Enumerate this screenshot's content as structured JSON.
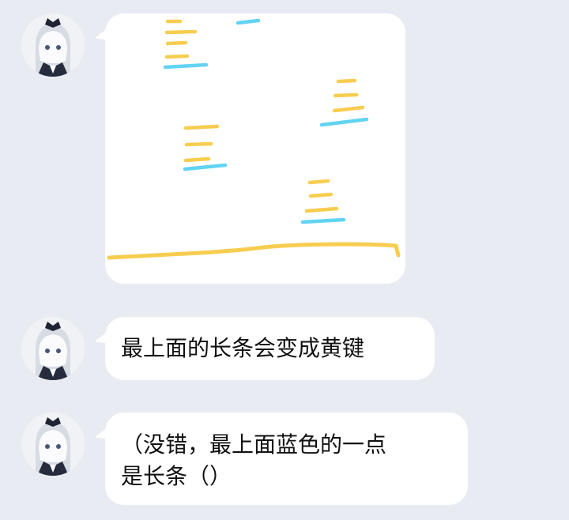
{
  "colors": {
    "background": "#e8ebf2",
    "bubble": "#ffffff",
    "yellow_stroke": "#f7cd4f",
    "blue_stroke": "#62d3f2"
  },
  "messages": [
    {
      "type": "image",
      "avatar_icon": "anime-girl-avatar-icon"
    },
    {
      "type": "text",
      "avatar_icon": "anime-girl-avatar-icon",
      "text": "最上面的长条会变成黄键"
    },
    {
      "type": "text",
      "avatar_icon": "anime-girl-avatar-icon",
      "text": "（没错，最上面蓝色的一点\n是长条（）"
    }
  ]
}
